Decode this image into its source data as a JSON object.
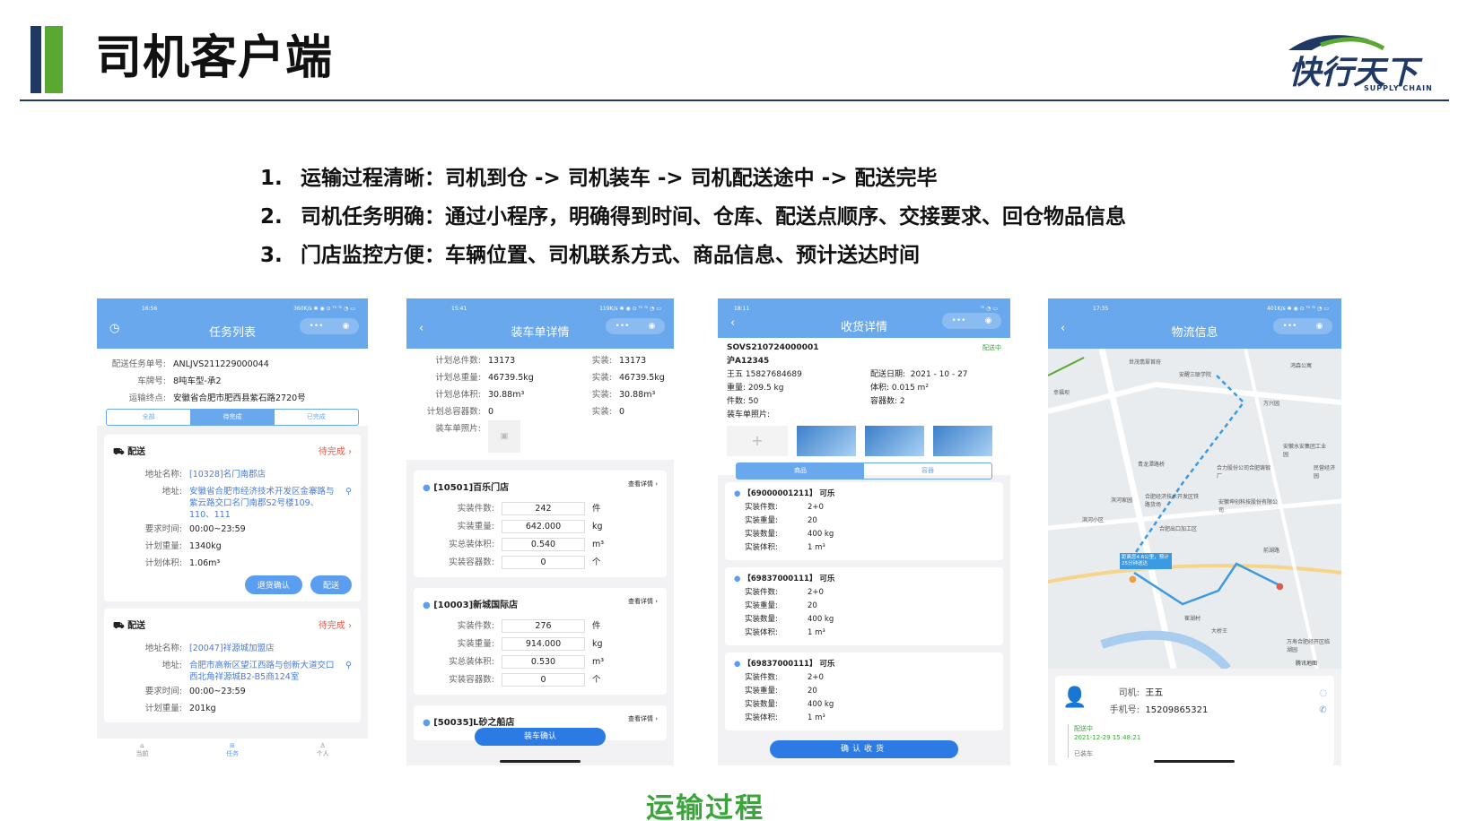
{
  "slide": {
    "title": "司机客户端",
    "logo": "快行天下",
    "logo_sub": "SUPPLY CHAIN",
    "points": [
      {
        "num": "1.",
        "text": "运输过程清晰：司机到仓 -> 司机装车 -> 司机配送途中 -> 配送完毕"
      },
      {
        "num": "2.",
        "text": "司机任务明确：通过小程序，明确得到时间、仓库、配送点顺序、交接要求、回仓物品信息"
      },
      {
        "num": "3.",
        "text": "门店监控方便：车辆位置、司机联系方式、商品信息、预计送达时间"
      }
    ],
    "caption": "运输过程"
  },
  "colors": {
    "header_blue": "#6aa8ee",
    "title_navy": "#1f3864",
    "accent_green": "#5aa832",
    "caption_green": "#3aa53a"
  },
  "phone1": {
    "status_time": "16:56",
    "status_right": "360K/s ✱ ◉ ⊙ ᵀᴵˡ ᵀᴵˡ ◔ ▭",
    "title": "任务列表",
    "caps": "•••",
    "info": [
      {
        "k": "配送任务单号:",
        "v": "ANLJVS211229000044"
      },
      {
        "k": "车牌号:",
        "v": "8吨车型-承2"
      },
      {
        "k": "运输终点:",
        "v": "安徽省合肥市肥西县紫石路2720号"
      }
    ],
    "segments": [
      "全部",
      "待完成",
      "已完成"
    ],
    "card1": {
      "type": "配送",
      "status": "待完成",
      "rows": [
        {
          "k": "地址名称:",
          "v": "[10328]名门南郡店"
        },
        {
          "k": "地址:",
          "v": "安徽省合肥市经济技术开发区金寨路与紫云路交口名门南郡S2号楼109、110、111"
        },
        {
          "k": "要求时间:",
          "v": "00:00~23:59"
        },
        {
          "k": "计划重量:",
          "v": "1340kg"
        },
        {
          "k": "计划体积:",
          "v": "1.06m³"
        }
      ],
      "btn_return": "退货确认",
      "btn_deliver": "配送"
    },
    "card2": {
      "type": "配送",
      "status": "待完成",
      "rows": [
        {
          "k": "地址名称:",
          "v": "[20047]祥源城加盟店"
        },
        {
          "k": "地址:",
          "v": "合肥市高新区望江西路与创新大道交口西北角祥源城B2-B5商124室"
        },
        {
          "k": "要求时间:",
          "v": "00:00~23:59"
        },
        {
          "k": "计划重量:",
          "v": "201kg"
        }
      ]
    },
    "tabs": [
      "当前",
      "任务",
      "个人"
    ]
  },
  "phone2": {
    "status_time": "15:41",
    "status_right": "119K/s ✱ ◉ ⊙ ᵀᴵˡ ᵀᴵˡ ◔ ▭",
    "title": "装车单详情",
    "caps": "•••",
    "summary": [
      {
        "k": "计划总件数:",
        "v": "13173",
        "k2": "实装:",
        "v2": "13173"
      },
      {
        "k": "计划总重量:",
        "v": "46739.5kg",
        "k2": "实装:",
        "v2": "46739.5kg"
      },
      {
        "k": "计划总体积:",
        "v": "30.88m³",
        "k2": "实装:",
        "v2": "30.88m³"
      },
      {
        "k": "计划总容器数:",
        "v": "0",
        "k2": "实装:",
        "v2": "0"
      }
    ],
    "photo_label": "装车单照片:",
    "stores": [
      {
        "name": "[10501]百乐门店",
        "link": "查看详情 ›",
        "count": "242",
        "weight": "642.000",
        "volume": "0.540",
        "containers": "0"
      },
      {
        "name": "[10003]新城国际店",
        "link": "查看详情 ›",
        "count": "276",
        "weight": "914.000",
        "volume": "0.530",
        "containers": "0"
      },
      {
        "name": "[50035]L砂之船店",
        "link": "查看详情 ›"
      }
    ],
    "field_labels": [
      "实装件数:",
      "实装重量:",
      "实总装体积:",
      "实装容器数:"
    ],
    "units": [
      "件",
      "kg",
      "m³",
      "个"
    ],
    "confirm": "装车确认"
  },
  "phone3": {
    "status_time": "18:11",
    "status_right": "ᵀᴵˡ ◔ ▭",
    "title": "收货详情",
    "caps": "•••",
    "order": "SOVS210724000001",
    "order_status": "配送中",
    "plate": "沪A12345",
    "driver": "王五  15827684689",
    "date_k": "配送日期:",
    "date_v": "2021 - 10 - 27",
    "weight_k": "重量:",
    "weight_v": "209.5 kg",
    "volume_k": "体积:",
    "volume_v": "0.015 m²",
    "count_k": "件数:",
    "count_v": "50",
    "cont_k": "容器数:",
    "cont_v": "2",
    "photo_label": "装车单照片:",
    "tabs": [
      "商品",
      "容器"
    ],
    "items": [
      {
        "title": "【69000001211】 可乐",
        "count": "2+0",
        "weight": "20",
        "qty": "400 kg",
        "vol": "1 m³"
      },
      {
        "title": "【69837000111】 可乐",
        "count": "2+0",
        "weight": "20",
        "qty": "400 kg",
        "vol": "1 m³"
      },
      {
        "title": "【69837000111】 可乐",
        "count": "2+0",
        "weight": "20",
        "qty": "400 kg",
        "vol": "1 m³"
      }
    ],
    "item_labels": [
      "实装件数:",
      "实装重量:",
      "实装数量:",
      "实装体积:"
    ],
    "confirm": "确认收货"
  },
  "phone4": {
    "status_time": "17:35",
    "status_right": "401K/s ✱ ◉ ⊙ ᵀᴵˡ ᵀᴵˡ ◔ ▭",
    "title": "物流信息",
    "caps": "•••",
    "map_labels": [
      "世茂翡翠首府",
      "安醒三联学院",
      "鸿森公寓",
      "幸福坝",
      "万兴园",
      "青龙潭路桥",
      "合力股份公司合肥铸锻厂",
      "安徽水安集团工业园",
      "民营经济园",
      "滨河家园",
      "合肥经济技术开发区铁路货场",
      "安徽坤创科技股份有限公司",
      "合肥出口加工区",
      "前湖路",
      "滨河小区",
      "崔湖村",
      "大桥王",
      "万寿合肥经开区临湖园",
      "腾讯地图"
    ],
    "eta": "距离您4.6公里，预计25分钟送达",
    "driver_k": "司机:",
    "driver_v": "王五",
    "phone_k": "手机号:",
    "phone_v": "15209865321",
    "timeline": [
      {
        "status": "配送中",
        "time": "2021-12-29 15:48:21"
      },
      {
        "status": "已装车"
      }
    ]
  }
}
